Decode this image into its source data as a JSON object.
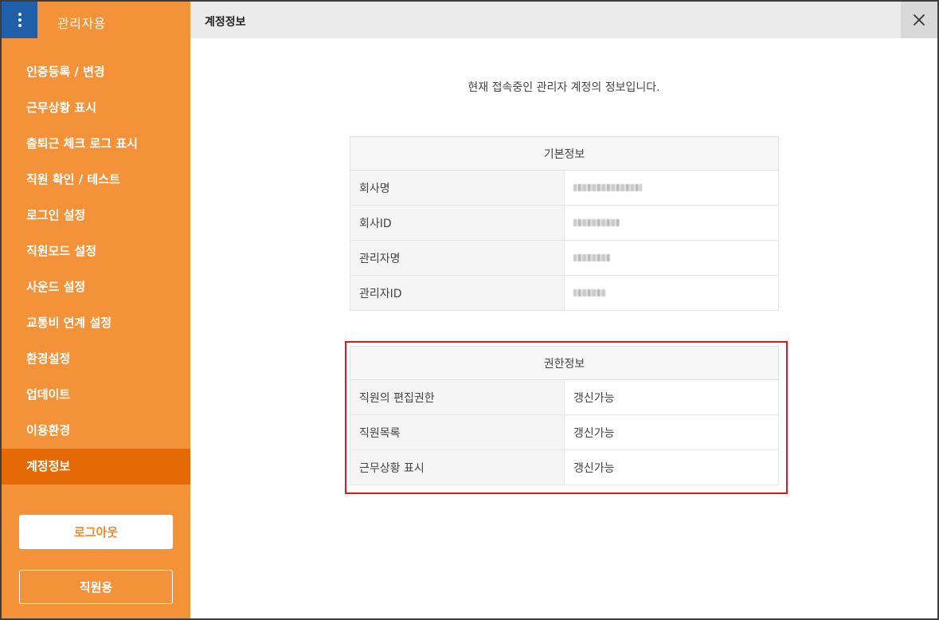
{
  "sidebar": {
    "title": "관리자용",
    "menu_icon": "kebab-vertical-icon",
    "items": [
      {
        "label": "인증등록 / 변경"
      },
      {
        "label": "근무상황 표시"
      },
      {
        "label": "출퇴근 체크 로그 표시"
      },
      {
        "label": "직원 확인 / 테스트"
      },
      {
        "label": "로그인 설정"
      },
      {
        "label": "직원모드 설정"
      },
      {
        "label": "사운드 설정"
      },
      {
        "label": "교통비 연계 설정"
      },
      {
        "label": "환경설정"
      },
      {
        "label": "업데이트"
      },
      {
        "label": "이용환경"
      },
      {
        "label": "계정정보",
        "active": true
      }
    ],
    "logout_label": "로그아웃",
    "staff_label": "직원용"
  },
  "header": {
    "title": "계정정보",
    "close_icon": "close-icon"
  },
  "main": {
    "intro": "현재 접속중인 관리자 계정의 정보입니다.",
    "basic": {
      "title": "기본정보",
      "rows": [
        {
          "key": "회사명",
          "value_redacted": true
        },
        {
          "key": "회사ID",
          "value_redacted": true
        },
        {
          "key": "관리자명",
          "value_redacted": true
        },
        {
          "key": "관리자ID",
          "value_redacted": true
        }
      ]
    },
    "permissions": {
      "title": "권한정보",
      "rows": [
        {
          "key": "직원의 편집권한",
          "value": "갱신가능"
        },
        {
          "key": "직원목록",
          "value": "갱신가능"
        },
        {
          "key": "근무상황 표시",
          "value": "갱신가능"
        }
      ]
    }
  },
  "colors": {
    "sidebar": "#f4923a",
    "sidebar_active": "#e56a06",
    "menu_button": "#1f5ea8",
    "highlight": "#e8131f"
  }
}
